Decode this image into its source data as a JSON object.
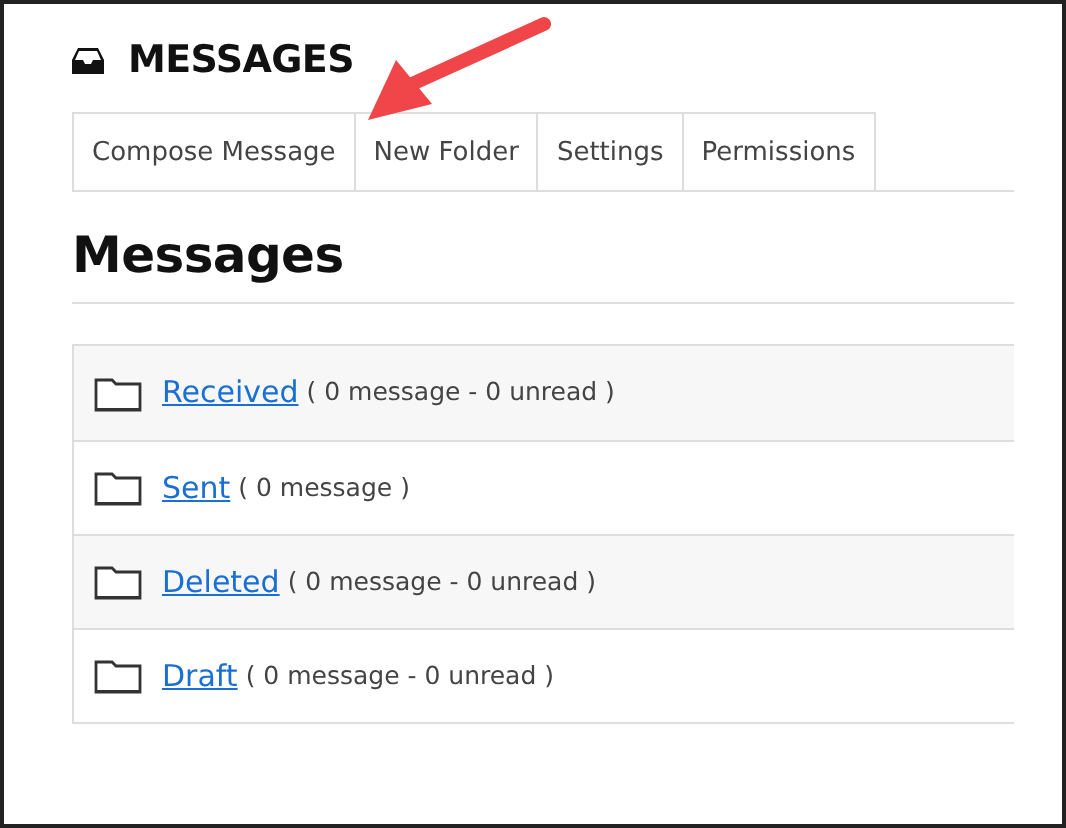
{
  "header": {
    "title": "MESSAGES"
  },
  "tabs": [
    {
      "label": "Compose Message"
    },
    {
      "label": "New Folder"
    },
    {
      "label": "Settings"
    },
    {
      "label": "Permissions"
    }
  ],
  "heading": "Messages",
  "folders": [
    {
      "name": "Received",
      "info": "( 0 message - 0 unread )"
    },
    {
      "name": "Sent",
      "info": "( 0 message )"
    },
    {
      "name": "Deleted",
      "info": "( 0 message - 0 unread )"
    },
    {
      "name": "Draft",
      "info": "( 0 message - 0 unread )"
    }
  ],
  "annotation": {
    "kind": "arrow"
  }
}
